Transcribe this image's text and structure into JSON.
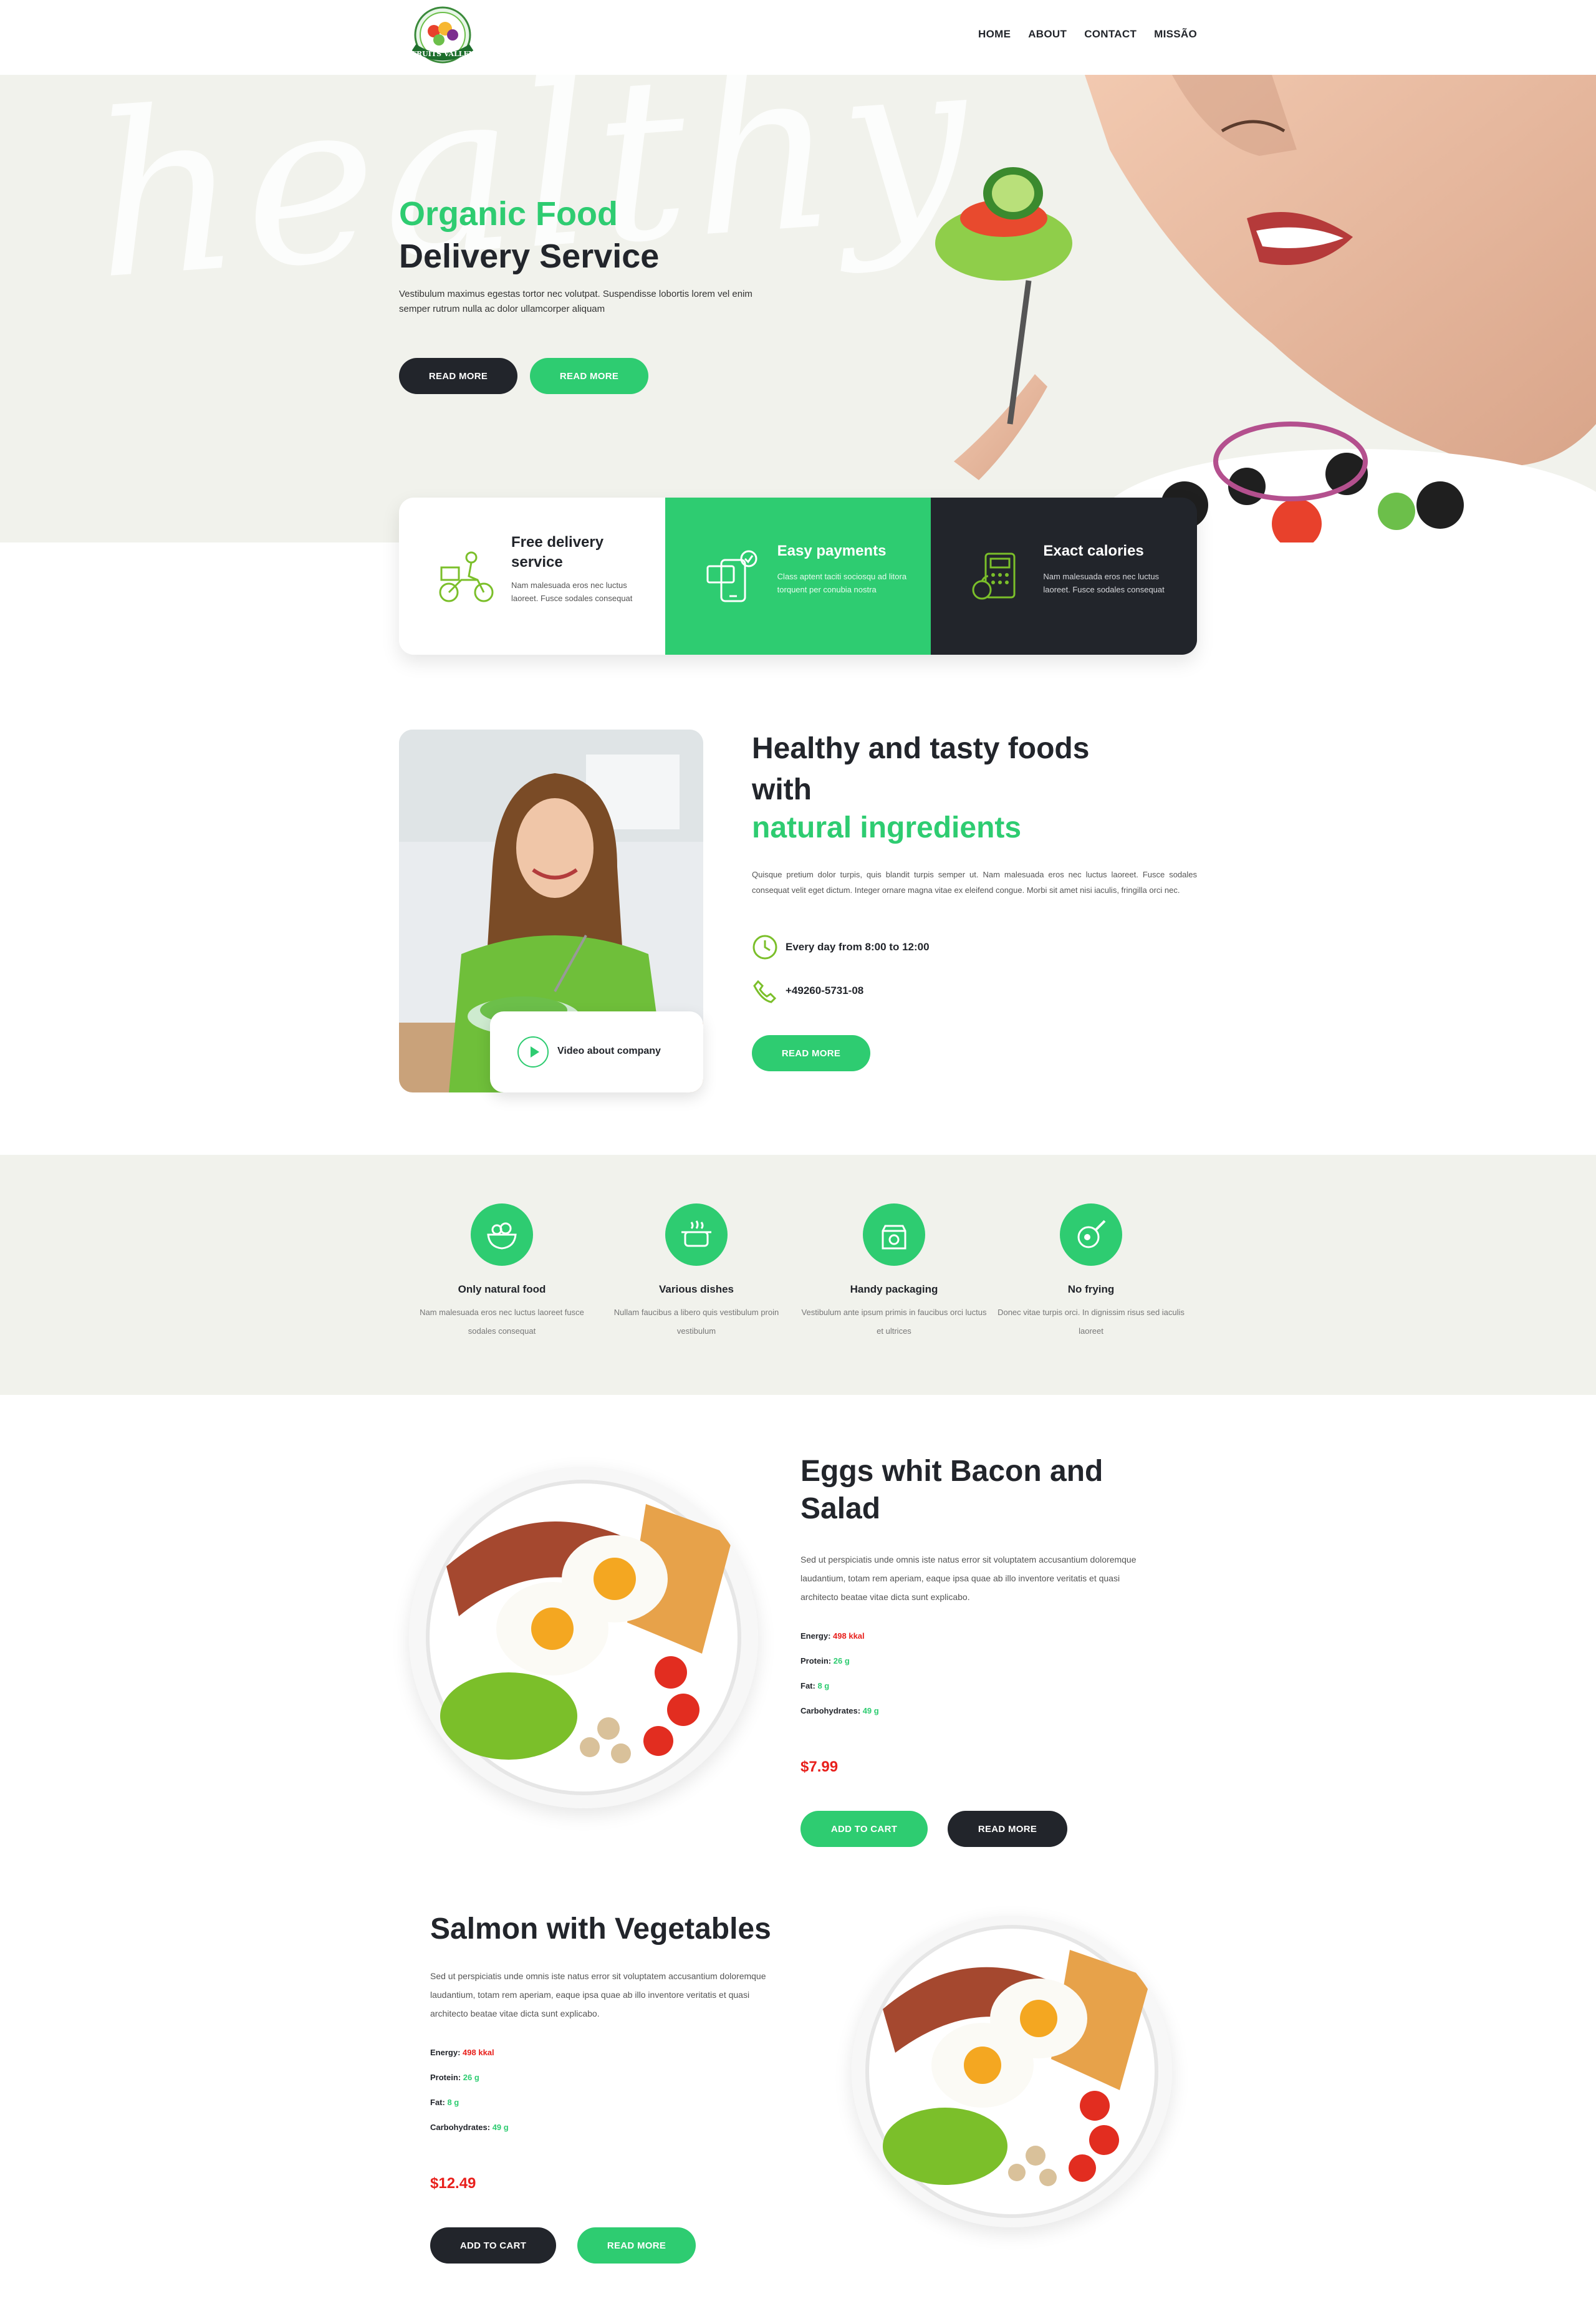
{
  "colors": {
    "brand_green": "#2ecc71",
    "dark": "#22252b",
    "price_red": "#e8201c",
    "bg_soft": "#f1f2ec"
  },
  "logo": {
    "brand": "FRUITS VALLEY"
  },
  "nav": {
    "items": [
      "HOME",
      "ABOUT",
      "CONTACT",
      "MISSÃO"
    ]
  },
  "hero": {
    "script_word": "healthy",
    "title_green": "Organic Food",
    "title_dark": "Delivery Service",
    "text": "Vestibulum maximus egestas tortor nec volutpat. Suspendisse lobortis lorem vel enim semper rutrum nulla ac dolor ullamcorper aliquam",
    "btn_primary": "READ MORE",
    "btn_secondary": "READ MORE"
  },
  "features": [
    {
      "icon": "delivery-scooter-icon",
      "title": "Free delivery service",
      "text": "Nam malesuada eros nec luctus laoreet. Fusce sodales consequat"
    },
    {
      "icon": "mobile-payment-icon",
      "title": "Easy payments",
      "text": "Class aptent taciti sociosqu ad litora torquent per conubia nostra"
    },
    {
      "icon": "calorie-calculator-icon",
      "title": "Exact calories",
      "text": "Nam malesuada eros nec luctus laoreet. Fusce sodales consequat"
    }
  ],
  "about": {
    "title_line1": "Healthy and tasty foods with",
    "title_green": "natural ingredients",
    "text": "Quisque pretium dolor turpis, quis blandit turpis semper ut. Nam malesuada eros nec luctus laoreet. Fusce sodales consequat velit eget dictum. Integer ornare magna vitae ex eleifend congue. Morbi sit amet nisi iaculis, fringilla orci nec.",
    "hours": "Every day from 8:00 to 12:00",
    "phone": "+49260-5731-08",
    "btn": "READ MORE",
    "video_label": "Video about company"
  },
  "benefits": [
    {
      "icon": "salad-bowl-icon",
      "title": "Only natural food",
      "text": "Nam malesuada eros nec luctus laoreet fusce sodales consequat"
    },
    {
      "icon": "cooking-pot-icon",
      "title": "Various dishes",
      "text": "Nullam faucibus a libero quis vestibulum proin vestibulum"
    },
    {
      "icon": "food-package-icon",
      "title": "Handy packaging",
      "text": "Vestibulum ante ipsum primis in faucibus orci luctus et ultrices"
    },
    {
      "icon": "frying-pan-icon",
      "title": "No frying",
      "text": "Donec vitae turpis orci. In dignissim risus sed iaculis laoreet"
    }
  ],
  "products": [
    {
      "title": "Eggs whit Bacon and Salad",
      "text": "Sed ut perspiciatis unde omnis iste natus error sit voluptatem accusantium doloremque laudantium, totam rem aperiam, eaque ipsa quae ab illo inventore veritatis et quasi architecto beatae vitae dicta sunt explicabo.",
      "nutrition": [
        {
          "label": "Energy:",
          "value": "498 kkal",
          "color": "red"
        },
        {
          "label": "Protein:",
          "value": "26 g",
          "color": "green"
        },
        {
          "label": "Fat:",
          "value": "8 g",
          "color": "green"
        },
        {
          "label": "Carbohydrates:",
          "value": "49 g",
          "color": "green"
        }
      ],
      "price": "$7.99",
      "btn_cart": "ADD TO CART",
      "btn_more": "READ MORE"
    },
    {
      "title": "Salmon with Vegetables",
      "text": "Sed ut perspiciatis unde omnis iste natus error sit voluptatem accusantium doloremque laudantium, totam rem aperiam, eaque ipsa quae ab illo inventore veritatis et quasi architecto beatae vitae dicta sunt explicabo.",
      "nutrition": [
        {
          "label": "Energy:",
          "value": "498 kkal",
          "color": "red"
        },
        {
          "label": "Protein:",
          "value": "26 g",
          "color": "green"
        },
        {
          "label": "Fat:",
          "value": "8 g",
          "color": "green"
        },
        {
          "label": "Carbohydrates:",
          "value": "49 g",
          "color": "green"
        }
      ],
      "price": "$12.49",
      "btn_cart": "ADD TO CART",
      "btn_more": "READ MORE"
    }
  ]
}
